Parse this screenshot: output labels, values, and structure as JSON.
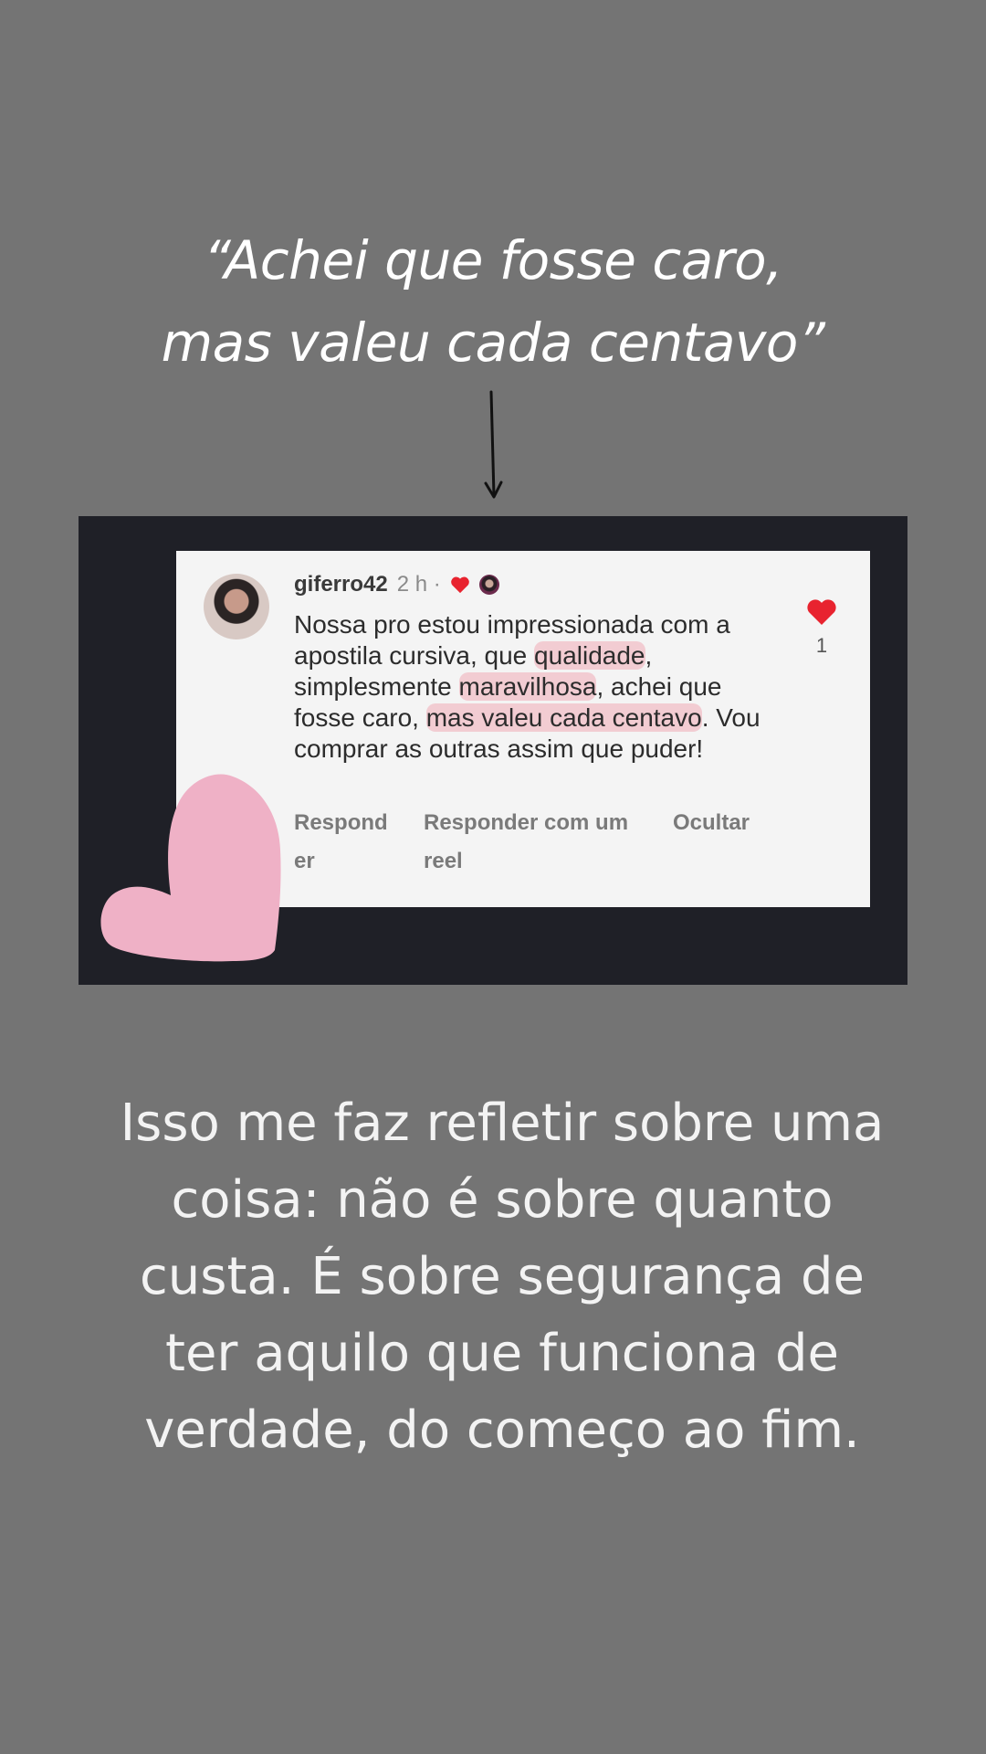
{
  "quote": {
    "line1": "“Achei que fosse caro,",
    "line2": "mas valeu cada centavo”"
  },
  "comment": {
    "username": "giferro42",
    "time": "2 h ·",
    "text_parts": [
      "Nossa pro estou impressionada com a apostila cursiva, que ",
      "qualidade",
      ", simplesmente ",
      "maravilhosa",
      ", achei que fosse caro, ",
      "mas valeu cada centavo",
      ". Vou comprar as outras assim que puder!"
    ],
    "actions": {
      "reply": "Responder",
      "reply_reel": "Responder com um reel",
      "hide": "Ocultar"
    },
    "like_count": "1"
  },
  "reflection": "Isso me faz refletir sobre uma coisa: não é sobre quanto custa. É sobre segurança de ter aquilo que funciona de verdade, do começo ao fim.",
  "colors": {
    "background": "#747474",
    "frame": "#1f2027",
    "card": "#f4f4f4",
    "like_red": "#e8232f",
    "heart_pink": "#efb1c6",
    "highlight": "#f08c9b"
  },
  "icons": [
    "arrow-down-icon",
    "heart-icon",
    "like-heart-icon",
    "decorative-heart-icon"
  ]
}
